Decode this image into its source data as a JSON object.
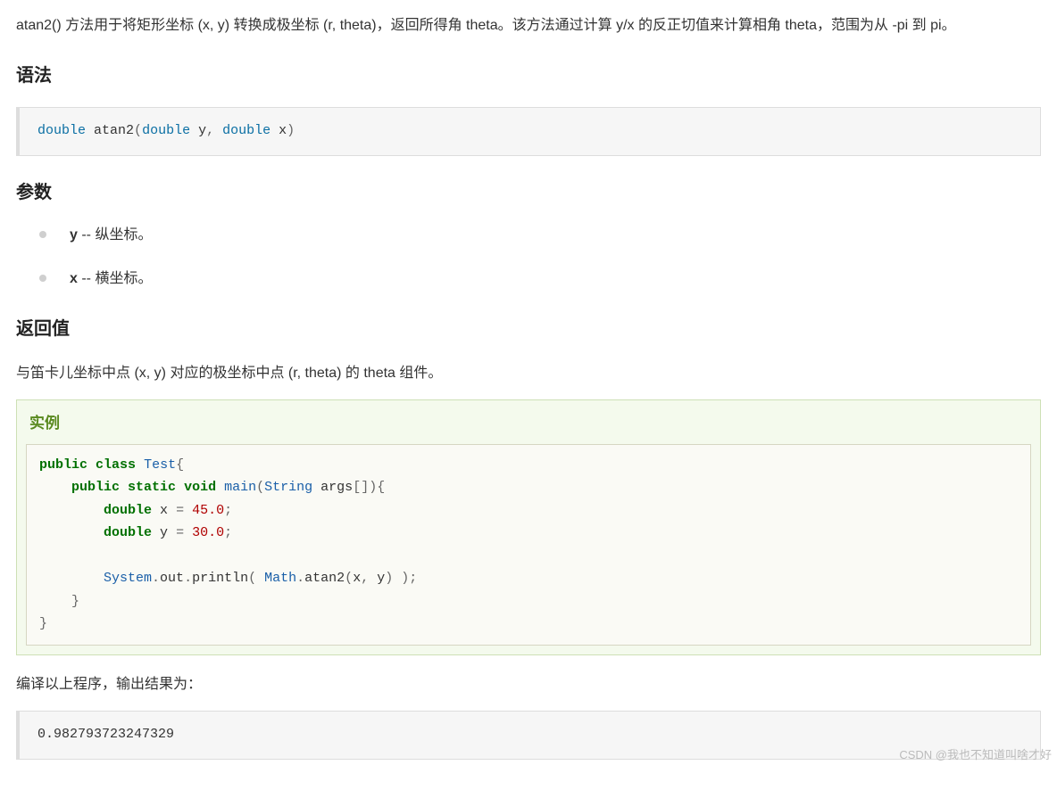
{
  "intro": "atan2() 方法用于将矩形坐标 (x, y) 转换成极坐标 (r, theta)，返回所得角 theta。该方法通过计算 y/x 的反正切值来计算相角 theta，范围为从 -pi 到 pi。",
  "headings": {
    "syntax": "语法",
    "params": "参数",
    "returns": "返回值"
  },
  "syntax": {
    "ret_type": "double",
    "func": "atan2",
    "p1_type": "double",
    "p1_name": "y",
    "p2_type": "double",
    "p2_name": "x"
  },
  "params": [
    {
      "name": "y",
      "sep": " -- ",
      "desc": "纵坐标。"
    },
    {
      "name": "x",
      "sep": " -- ",
      "desc": "横坐标。"
    }
  ],
  "returns_text": "与笛卡儿坐标中点 (x, y) 对应的极坐标中点 (r, theta) 的 theta 组件。",
  "example": {
    "title": "实例",
    "tokens": {
      "public": "public",
      "class": "class",
      "Test": "Test",
      "lbrace": "{",
      "rbrace": "}",
      "static": "static",
      "void": "void",
      "main": "main",
      "lparen": "(",
      "rparen": ")",
      "String": "String",
      "args": "args",
      "brackets": "[]",
      "double": "double",
      "x": "x",
      "y": "y",
      "eq": "=",
      "v1": "45.0",
      "v2": "30.0",
      "semi": ";",
      "System": "System",
      "dot": ".",
      "out": "out",
      "println": "println",
      "Math": "Math",
      "atan2": "atan2",
      "comma": ",",
      "sp": " "
    }
  },
  "compile_text": "编译以上程序，输出结果为：",
  "output": "0.982793723247329",
  "watermark": "CSDN @我也不知道叫啥才好"
}
